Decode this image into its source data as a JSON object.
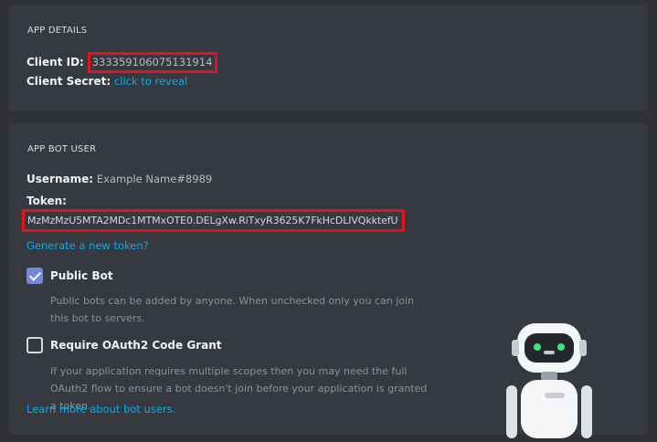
{
  "app_details": {
    "section_title": "APP DETAILS",
    "client_id_label": "Client ID:",
    "client_id_value": "333359106075131914",
    "client_secret_label": "Client Secret:",
    "client_secret_link": "click to reveal"
  },
  "bot_user": {
    "section_title": "APP BOT USER",
    "username_label": "Username:",
    "username_value": "Example Name#8989",
    "token_label": "Token:",
    "token_value": "MzMzMzU5MTA2MDc1MTMxOTE0.DELgXw.RiTxyR3625K7FkHcDLIVQkktefU",
    "generate_token_link": "Generate a new token?",
    "public_bot": {
      "label": "Public Bot",
      "checked": true,
      "description": "Public bots can be added by anyone. When unchecked only you can join this bot to servers."
    },
    "oauth2_grant": {
      "label": "Require OAuth2 Code Grant",
      "checked": false,
      "description": "If your application requires multiple scopes then you may need the full OAuth2 flow to ensure a bot doesn't join before your application is granted a token."
    },
    "learn_more_link": "Learn more about bot users."
  },
  "colors": {
    "background": "#2f3136",
    "card": "#36393f",
    "highlight_border": "#e2121f",
    "link": "#00b0f4",
    "checkbox_checked": "#7289da"
  },
  "icons": {
    "robot": "robot-illustration-icon",
    "check": "checkmark-icon"
  }
}
